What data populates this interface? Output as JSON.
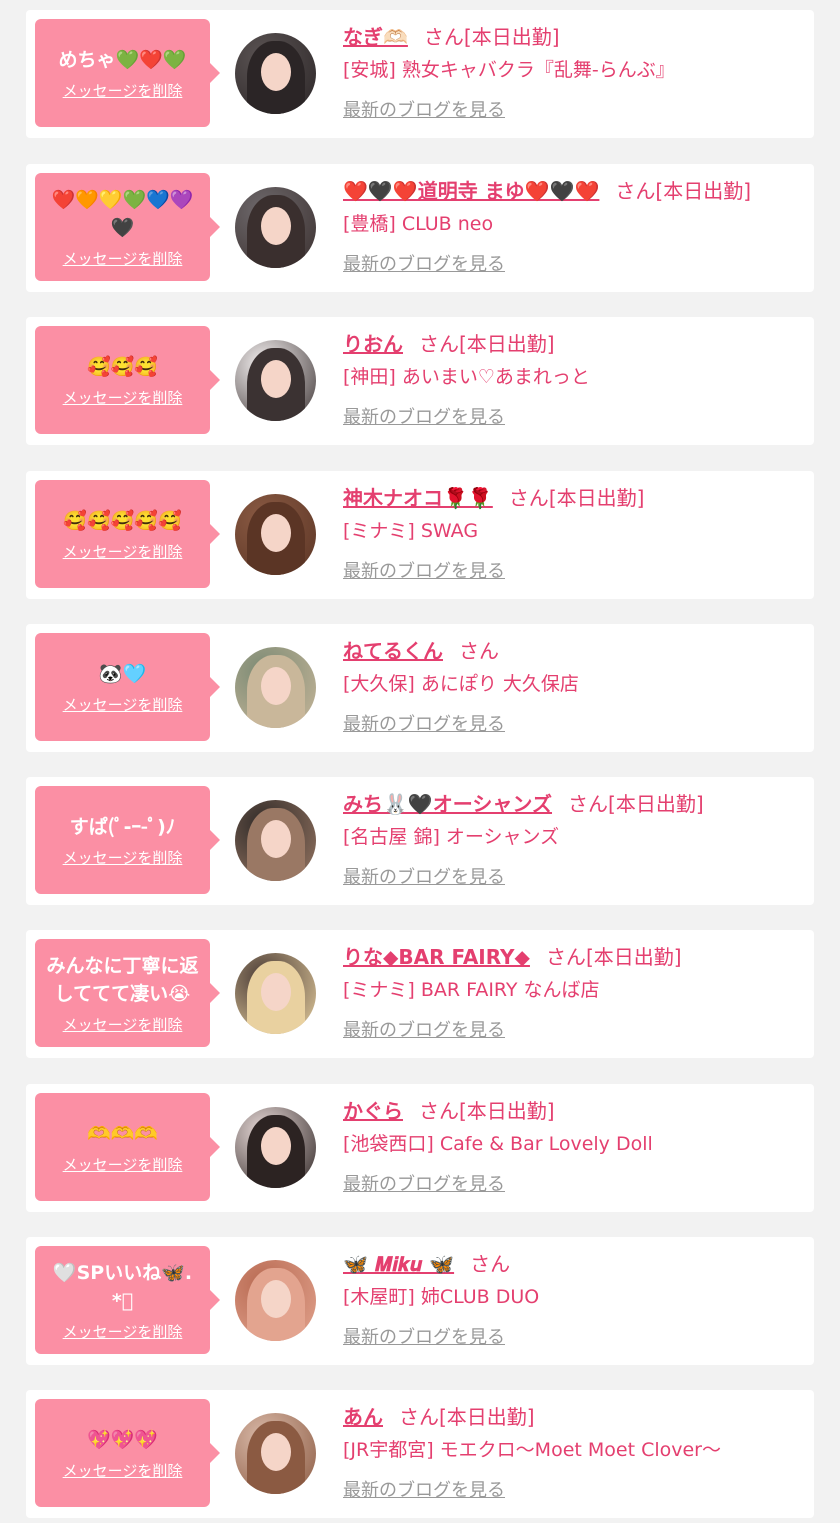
{
  "delete_label": "メッセージを削除",
  "blog_label": "最新のブログを見る",
  "colors": {
    "page_bg": "#f2f2f2",
    "bubble": "#fb8fa4",
    "accent": "#e43f6f",
    "muted": "#999999"
  },
  "messages": [
    {
      "message": "めちゃ💚❤️💚",
      "name": "なぎ🫶🏻",
      "suffix": "さん",
      "status": "[本日出勤]",
      "shop": "[安城] 熟女キャバクラ『乱舞-らんぶ』",
      "avatar_colors": [
        "#5b5454",
        "#2b2526"
      ]
    },
    {
      "message": "❤️🧡💛💚💙💜🖤",
      "name": "❤️🖤❤️道明寺 まゆ❤️🖤❤️",
      "suffix": "さん",
      "status": "[本日出勤]",
      "shop": "[豊橋] CLUB neo",
      "avatar_colors": [
        "#6f6a6d",
        "#3a2f2e"
      ]
    },
    {
      "message": "🥰🥰🥰",
      "name": "りおん",
      "suffix": "さん",
      "status": "[本日出勤]",
      "shop": "[神田] あいまい♡あまれっと",
      "avatar_colors": [
        "#f6f2f2",
        "#3b3232"
      ]
    },
    {
      "message": "🥰🥰🥰🥰🥰",
      "name": "神木ナオコ🌹🌹",
      "suffix": "さん",
      "status": "[本日出勤]",
      "shop": "[ミナミ] SWAG",
      "avatar_colors": [
        "#8a5a43",
        "#5b3525"
      ]
    },
    {
      "message": "🐼🩵",
      "name": "ねてるくん",
      "suffix": "さん",
      "status": "",
      "shop": "[大久保] あにぽり 大久保店",
      "avatar_colors": [
        "#7b8a74",
        "#c9b79a"
      ]
    },
    {
      "message": "すぱ(ﾟ-ｰ-ﾟ)ﾉ",
      "name": "みち🐰🖤オーシャンズ",
      "suffix": "さん",
      "status": "[本日出勤]",
      "shop": "[名古屋 錦] オーシャンズ",
      "avatar_colors": [
        "#2f2a28",
        "#9a7864"
      ]
    },
    {
      "message": "みんなに丁寧に返しててて凄い😭",
      "name": "りな◆BAR FAIRY◆",
      "suffix": "さん",
      "status": "[本日出勤]",
      "shop": "[ミナミ] BAR FAIRY なんば店",
      "avatar_colors": [
        "#4a3b36",
        "#e9d1a0"
      ]
    },
    {
      "message": "🫶🫶🫶",
      "name": "かぐら",
      "suffix": "さん",
      "status": "[本日出勤]",
      "shop": "[池袋西口] Cafe & Bar Lovely Doll",
      "avatar_colors": [
        "#e8dad8",
        "#2c2322"
      ]
    },
    {
      "message": "🤍SPいいね🦋.*ﾟ",
      "name": "🦋 𝑴𝒊𝒌𝒖 🦋",
      "suffix": "さん",
      "status": "",
      "shop": "[木屋町] 姉CLUB DUO",
      "avatar_colors": [
        "#b86a52",
        "#e3a48f"
      ]
    },
    {
      "message": "💖💖💖",
      "name": "あん",
      "suffix": "さん",
      "status": "[本日出勤]",
      "shop": "[JR宇都宮] モエクロ〜Moet Moet Clover〜",
      "avatar_colors": [
        "#d9b9a8",
        "#8b5a42"
      ]
    }
  ]
}
